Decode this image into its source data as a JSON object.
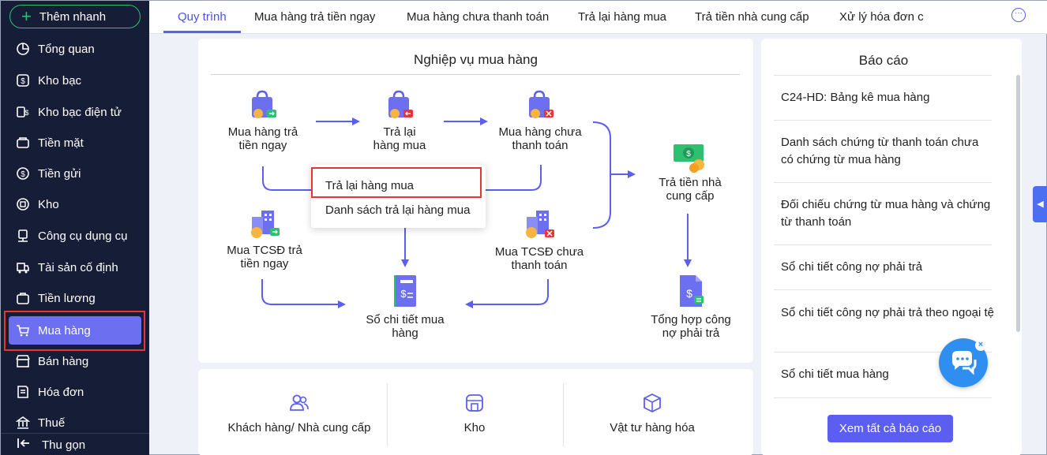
{
  "sidebar": {
    "quick_add": "Thêm nhanh",
    "items": [
      {
        "label": "Tổng quan",
        "icon": "dashboard-icon"
      },
      {
        "label": "Kho bạc",
        "icon": "treasury-icon"
      },
      {
        "label": "Kho bạc điện tử",
        "icon": "e-treasury-icon"
      },
      {
        "label": "Tiền mặt",
        "icon": "cash-icon"
      },
      {
        "label": "Tiền gửi",
        "icon": "deposit-icon"
      },
      {
        "label": "Kho",
        "icon": "warehouse-icon"
      },
      {
        "label": "Công cụ dụng cụ",
        "icon": "tools-icon"
      },
      {
        "label": "Tài sản cố định",
        "icon": "fixed-asset-icon"
      },
      {
        "label": "Tiền lương",
        "icon": "salary-icon"
      },
      {
        "label": "Mua hàng",
        "icon": "cart-icon",
        "active": true
      },
      {
        "label": "Bán hàng",
        "icon": "sales-icon"
      },
      {
        "label": "Hóa đơn",
        "icon": "invoice-icon"
      },
      {
        "label": "Thuế",
        "icon": "tax-icon"
      }
    ],
    "collapse": "Thu gọn"
  },
  "tabs": [
    {
      "label": "Quy trình",
      "active": true
    },
    {
      "label": "Mua hàng trả tiền ngay"
    },
    {
      "label": "Mua hàng chưa thanh toán"
    },
    {
      "label": "Trả lại hàng mua"
    },
    {
      "label": "Trả tiền nhà cung cấp"
    },
    {
      "label": "Xử lý hóa đơn c"
    }
  ],
  "flow": {
    "title": "Nghiệp vụ mua hàng",
    "nodes": {
      "buy_pay_now": "Mua hàng trả\ntiền ngay",
      "return": "Trả lại\nhàng mua",
      "buy_unpaid": "Mua hàng chưa\nthanh toán",
      "pay_supplier": "Trả tiền nhà\ncung cấp",
      "asset_pay_now": "Mua TCSĐ trả\ntiền ngay",
      "ledger": "Sổ chi tiết mua\nhàng",
      "asset_unpaid": "Mua TCSĐ chưa\nthanh toán",
      "summary": "Tổng hợp công\nnợ phải trả"
    },
    "popup": {
      "item1": "Trả lại hàng mua",
      "item2": "Danh sách trả lại hàng mua"
    }
  },
  "categories": {
    "customers": "Khách hàng/ Nhà cung cấp",
    "warehouse": "Kho",
    "goods": "Vật tư hàng hóa"
  },
  "reports": {
    "title": "Báo cáo",
    "items": [
      "C24-HD: Bảng kê mua hàng",
      "Danh sách chứng từ thanh toán chưa có chứng từ mua hàng",
      "Đối chiếu chứng từ mua hàng và chứng từ thanh toán",
      "Sổ chi tiết công nợ phải trả",
      "Sổ chi tiết công nợ phải trả theo ngoại tệ",
      "Sổ chi tiết mua hàng"
    ],
    "view_all": "Xem tất cả báo cáo"
  },
  "colors": {
    "sidebar_bg": "#161d36",
    "accent": "#5b5ef0",
    "highlight": "#e63535"
  }
}
